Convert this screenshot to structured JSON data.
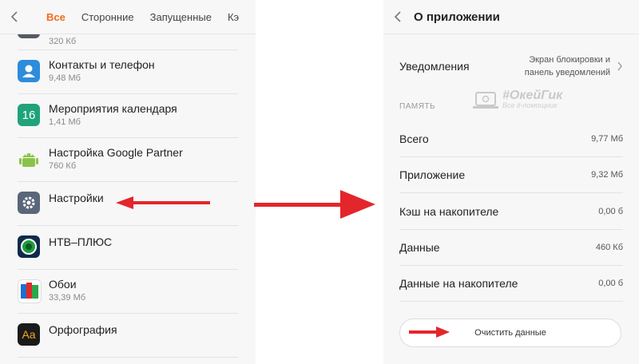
{
  "left": {
    "tabs": [
      "Все",
      "Сторонние",
      "Запущенные",
      "Кэ"
    ],
    "apps": [
      {
        "name": "",
        "size": "320 Кб"
      },
      {
        "name": "Контакты и телефон",
        "size": "9,48 Мб"
      },
      {
        "name": "Мероприятия календаря",
        "size": "1,41 Мб"
      },
      {
        "name": "Настройка Google Partner",
        "size": "760 Кб"
      },
      {
        "name": "Настройки",
        "size": ""
      },
      {
        "name": "НТВ–ПЛЮС",
        "size": ""
      },
      {
        "name": "Обои",
        "size": "33,39 Мб"
      },
      {
        "name": "Орфография",
        "size": ""
      }
    ],
    "calendar_icon_text": "16",
    "orfo_icon_text": "Aa"
  },
  "right": {
    "title": "О приложении",
    "notifications": {
      "label": "Уведомления",
      "value_line1": "Экран блокировки и",
      "value_line2": "панель уведомлений"
    },
    "section_memory": "ПАМЯТЬ",
    "watermark": {
      "line1": "#ОкейГик",
      "line2": "Все it-помощник"
    },
    "rows": [
      {
        "label": "Всего",
        "value": "9,77 Мб"
      },
      {
        "label": "Приложение",
        "value": "9,32 Мб"
      },
      {
        "label": "Кэш на накопителе",
        "value": "0,00 б"
      },
      {
        "label": "Данные",
        "value": "460 Кб"
      },
      {
        "label": "Данные на накопителе",
        "value": "0,00 б"
      }
    ],
    "clear_button": "Очистить данные"
  },
  "colors": {
    "accent_tab": "#f26b1d",
    "arrow": "#e3262b"
  },
  "icons": [
    "chevron-left-icon",
    "contacts-icon",
    "calendar-icon",
    "android-icon",
    "settings-gear-icon",
    "ntv-icon",
    "wallpaper-icon",
    "spelling-icon",
    "chevron-right-icon",
    "laptop-icon"
  ]
}
